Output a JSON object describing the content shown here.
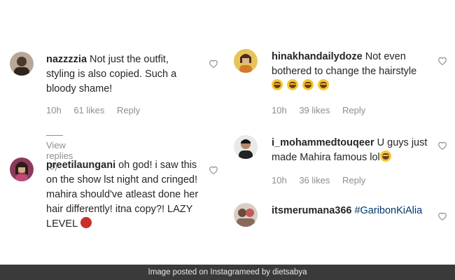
{
  "left_column": {
    "comment1": {
      "username": "nazzzzia",
      "text": "Not just the outfit, styling is also copied. Such a bloody shame!",
      "time": "10h",
      "likes": "61 likes",
      "reply": "Reply",
      "view_replies": "View replies (3)"
    },
    "comment2": {
      "username": "preetilaungani",
      "text": "oh god! i saw this on the show lst night and cringed! mahira should've atleast done her hair differently! itna copy?! LAZY LEVEL",
      "emoji": "angry-face-emoji"
    }
  },
  "right_column": {
    "comment1": {
      "username": "hinakhandailydoze",
      "text": "Not even bothered to change the hairstyle",
      "emoji_count": 4,
      "emoji": "laughing-crying-emoji",
      "time": "10h",
      "likes": "39 likes",
      "reply": "Reply"
    },
    "comment2": {
      "username": "i_mohammedtouqeer",
      "text": "U guys just made Mahira famous lol",
      "emoji": "laughing-crying-emoji",
      "time": "10h",
      "likes": "36 likes",
      "reply": "Reply"
    },
    "comment3": {
      "username": "itsmerumana366",
      "hashtag": "#GaribonKiAlia"
    }
  },
  "footer": {
    "caption": "Image posted on Instagrameed by dietsabya"
  }
}
